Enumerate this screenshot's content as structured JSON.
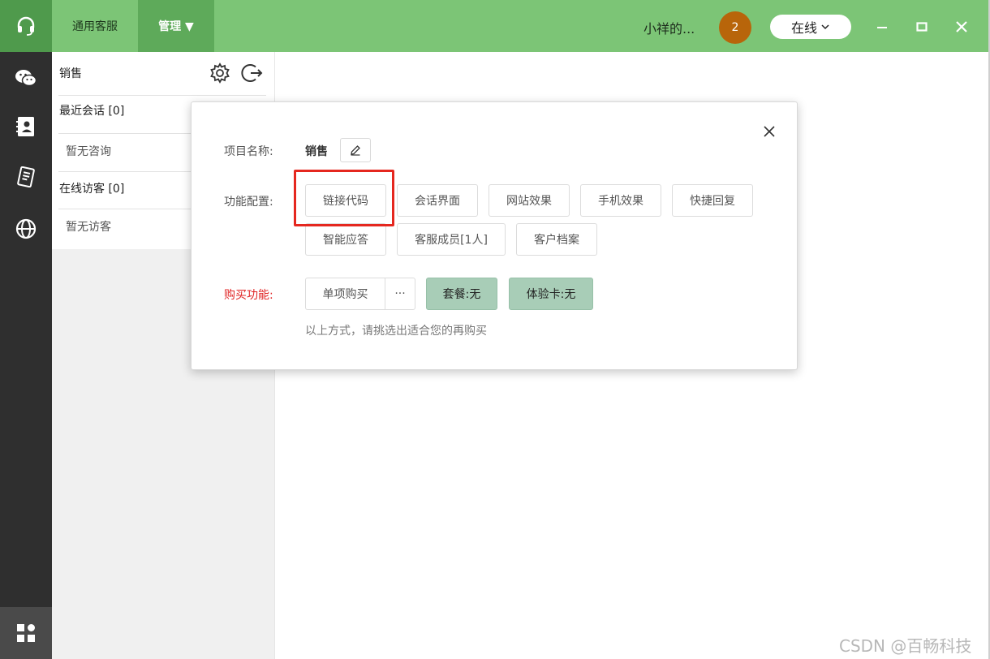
{
  "header": {
    "tabs": [
      {
        "label": "通用客服"
      },
      {
        "label": "管理 ▼"
      }
    ],
    "user_name": "小祥的...",
    "badge_count": "2",
    "status_label": "在线",
    "colors": {
      "bar": "#7cc576",
      "active_tab": "#5eaa5a",
      "badge": "#b8650a"
    }
  },
  "rail": {
    "icons": [
      "headset-icon",
      "wechat-icon",
      "contacts-icon",
      "records-icon",
      "globe-icon",
      "apps-icon"
    ]
  },
  "sidebar": {
    "title": "销售",
    "recent_label": "最近会话 [0]",
    "recent_empty": "暂无咨询",
    "visitors_label": "在线访客 [0]",
    "visitors_empty": "暂无访客"
  },
  "modal": {
    "project_label": "项目名称:",
    "project_value": "销售",
    "config_label": "功能配置:",
    "config_buttons": [
      "链接代码",
      "会话界面",
      "网站效果",
      "手机效果",
      "快捷回复",
      "智能应答",
      "客服成员[1人]",
      "客户档案"
    ],
    "buy_label": "购买功能:",
    "buy_single": "单项购买",
    "buy_more": "···",
    "package_label": "套餐:无",
    "trial_label": "体验卡:无",
    "hint": "以上方式，请挑选出适合您的再购买"
  },
  "watermark": "CSDN @百畅科技"
}
